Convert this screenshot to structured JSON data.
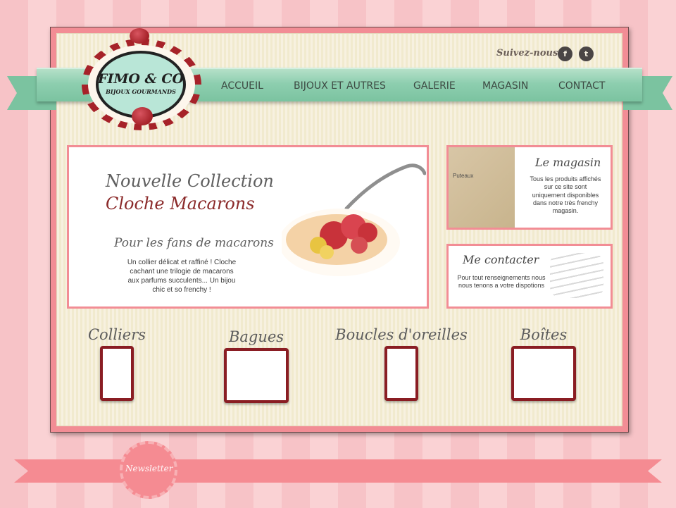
{
  "header": {
    "follow_label": "Suivez-nous",
    "social_links": [
      {
        "label": "f",
        "icon": "facebook-icon"
      },
      {
        "label": "t",
        "icon": "twitter-icon"
      }
    ]
  },
  "logo": {
    "title": "FIMO & CO",
    "subtitle": "BIJOUX GOURMANDS"
  },
  "nav": {
    "items": [
      "ACCUEIL",
      "BIJOUX ET AUTRES",
      "GALERIE",
      "MAGASIN",
      "CONTACT"
    ]
  },
  "banner": {
    "line_1": "Nouvelle Collection",
    "line_2": "Cloche Macarons",
    "tagline": "Pour les fans de macarons",
    "copy": "Un collier délicat et raffiné ! Cloche cachant une trilogie de macarons aux parfums succulents... Un bijou chic et so frenchy !"
  },
  "panels": {
    "store": {
      "title": "Le magasin",
      "body": "Tous les produits affichés sur ce site sont uniquement disponibles dans notre très frenchy magasin.",
      "map_label": "Puteaux"
    },
    "contact": {
      "title": "Me contacter",
      "body": "Pour tout renseignements nous nous tenons a votre dispotions"
    }
  },
  "categories": [
    {
      "label": "Colliers"
    },
    {
      "label": "Bagues"
    },
    {
      "label": "Boucles d'oreilles"
    },
    {
      "label": "Boîtes"
    }
  ],
  "newsletter": {
    "label": "Newsletter"
  },
  "colors": {
    "accent": "#f28d95",
    "mint": "#7bc3a0",
    "burgundy": "#8a1d23"
  }
}
